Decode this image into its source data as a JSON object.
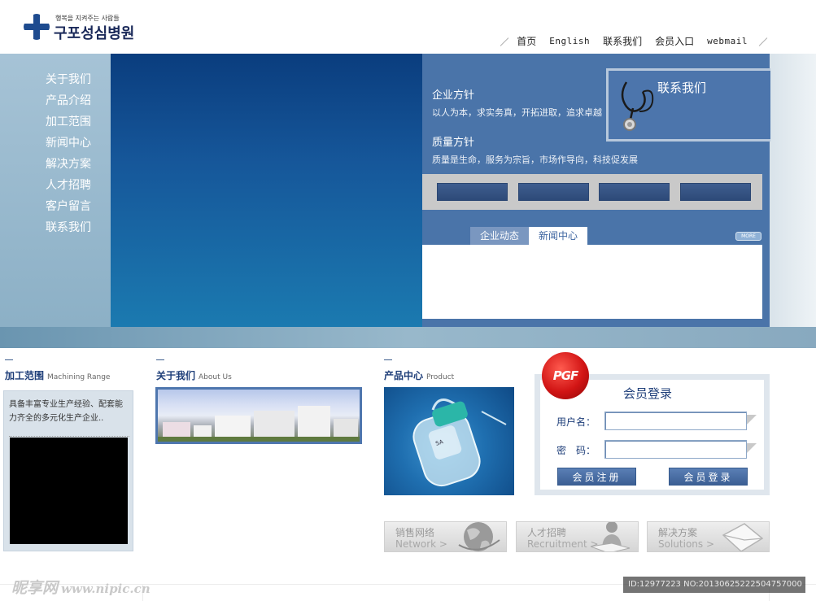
{
  "header": {
    "logo_tagline": "행복을 지켜주는 사람들",
    "logo_name": "구포성심병원",
    "nav": [
      "首页",
      "English",
      "联系我们",
      "会员入口",
      "webmail"
    ]
  },
  "sidebar": {
    "items": [
      {
        "label": "关于我们"
      },
      {
        "label": "产品介绍"
      },
      {
        "label": "加工范围"
      },
      {
        "label": "新闻中心"
      },
      {
        "label": "解决方案"
      },
      {
        "label": "人才招聘"
      },
      {
        "label": "客户留言"
      },
      {
        "label": "联系我们"
      }
    ]
  },
  "policies": {
    "enterprise_title": "企业方针",
    "enterprise_text": "以人为本，求实务真，开拓进取，追求卓越",
    "quality_title": "质量方针",
    "quality_text": "质量是生命，服务为宗旨，市场作导向，科技促发展"
  },
  "contact": {
    "title": "联系我们"
  },
  "news": {
    "tabs": [
      "企业动态",
      "新闻中心"
    ],
    "active_tab": "新闻中心",
    "more": "MORE"
  },
  "sections": {
    "machining": {
      "cn": "加工范围",
      "en": "Machining Range",
      "text": "具备丰富专业生产经验、配套能力齐全的多元化生产企业.."
    },
    "about": {
      "cn": "关于我们",
      "en": "About Us"
    },
    "product": {
      "cn": "产品中心",
      "en": "Product"
    }
  },
  "login": {
    "badge": "PGF",
    "title": "会员登录",
    "username_label": "用户名：",
    "password_label": "密　码：",
    "register_button": "会员注册",
    "login_button": "会员登录"
  },
  "quicklinks": [
    {
      "cn": "销售网络",
      "en": "Network  >",
      "icon": "globe-icon"
    },
    {
      "cn": "人才招聘",
      "en": "Recruitment  >",
      "icon": "person-icon"
    },
    {
      "cn": "解决方案",
      "en": "Solutions  >",
      "icon": "envelope-icon"
    }
  ],
  "footer": {
    "watermark": "昵享网",
    "watermark_url": "www.nipic.cn",
    "image_id": "ID:12977223 NO:20130625222504757000"
  },
  "colors": {
    "brand_blue": "#1d3d78",
    "panel_blue": "#4a74a9",
    "hero_dark": "#0a3d7e",
    "badge_red": "#d21515"
  }
}
